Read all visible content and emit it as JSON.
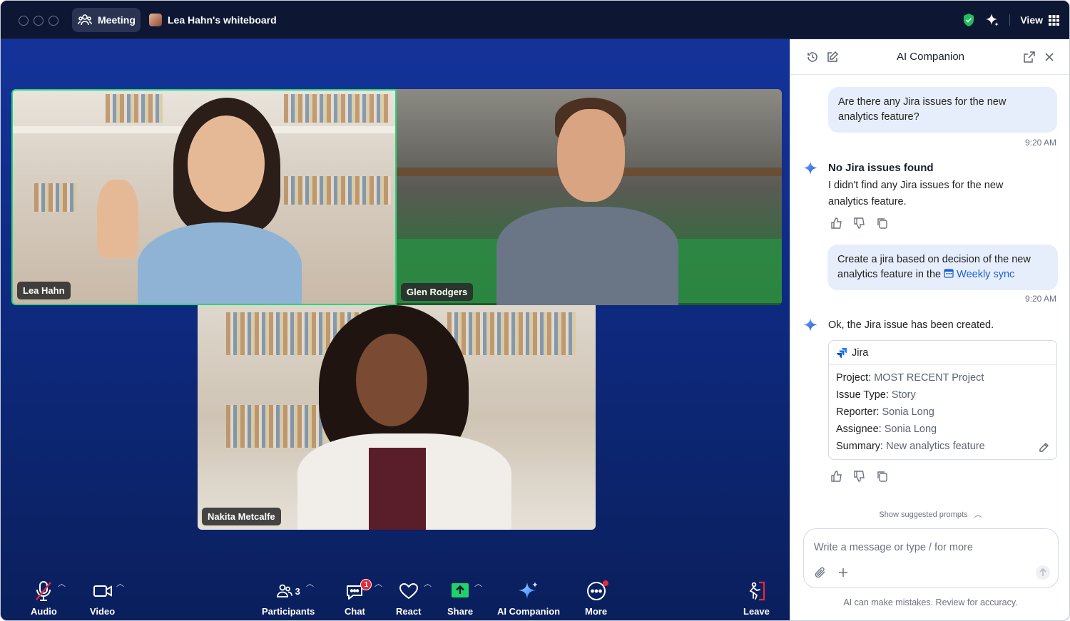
{
  "titlebar": {
    "meeting_tab": "Meeting",
    "whiteboard_tab": "Lea Hahn's whiteboard",
    "view_label": "View",
    "colors": {
      "security_shield": "#1fbf5c"
    }
  },
  "participants": [
    {
      "name": "Lea Hahn",
      "active_speaker": true
    },
    {
      "name": "Glen Rodgers",
      "active_speaker": false
    },
    {
      "name": "Nakita Metcalfe",
      "active_speaker": false
    }
  ],
  "toolbar": {
    "audio": "Audio",
    "video": "Video",
    "participants": "Participants",
    "participants_count": "3",
    "chat": "Chat",
    "chat_badge": "1",
    "react": "React",
    "share": "Share",
    "ai_companion": "AI Companion",
    "more": "More",
    "leave": "Leave"
  },
  "panel": {
    "title": "AI Companion",
    "messages": [
      {
        "role": "user",
        "text": "Are there any Jira issues for the new analytics feature?",
        "time": "9:20 AM"
      },
      {
        "role": "ai",
        "title": "No Jira issues found",
        "text": "I didn't find any Jira issues for the new analytics feature."
      },
      {
        "role": "user",
        "text_prefix": "Create a jira based on decision of the new analytics feature in the",
        "link": "Weekly sync",
        "time": "9:20 AM"
      },
      {
        "role": "ai",
        "text": "Ok, the Jira issue has been created."
      }
    ],
    "jira_card": {
      "title": "Jira",
      "fields": [
        {
          "label": "Project:",
          "value": "MOST RECENT Project"
        },
        {
          "label": "Issue Type:",
          "value": "Story"
        },
        {
          "label": "Reporter:",
          "value": "Sonia Long"
        },
        {
          "label": "Assignee:",
          "value": "Sonia Long"
        },
        {
          "label": "Summary:",
          "value": "New analytics feature"
        }
      ]
    },
    "suggested_prompts": "Show suggested prompts",
    "composer_placeholder": "Write a message or type / for more",
    "disclaimer": "AI can make mistakes. Review for accuracy."
  }
}
